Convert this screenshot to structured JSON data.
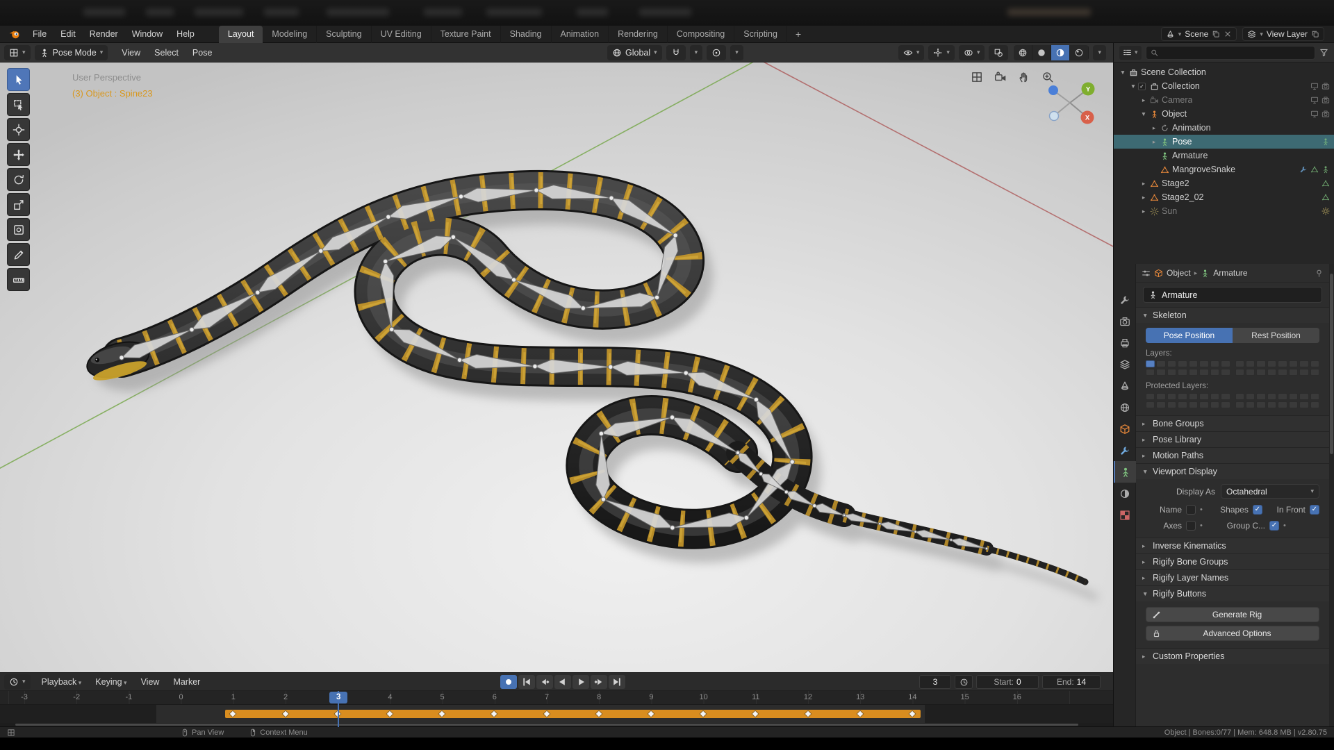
{
  "colors": {
    "accent": "#4772b3",
    "selection_teal": "#3d6a73",
    "keyframe_band": "#d98d1f",
    "snake_body": "#262626",
    "snake_band": "#c9992a",
    "axis_green": "#6da33c",
    "axis_red": "#a84848"
  },
  "icons": {
    "chevron-down": "▾",
    "triangle-right": "▸",
    "triangle-down": "▼",
    "dot": "•",
    "check": "✓"
  },
  "topbar": {
    "menus": [
      "File",
      "Edit",
      "Render",
      "Window",
      "Help"
    ],
    "workspaces": [
      "Layout",
      "Modeling",
      "Sculpting",
      "UV Editing",
      "Texture Paint",
      "Shading",
      "Animation",
      "Rendering",
      "Compositing",
      "Scripting"
    ],
    "active_workspace": "Layout",
    "add_tab_label": "+",
    "scene_label": "Scene",
    "view_layer_label": "View Layer"
  },
  "viewport_header": {
    "mode": "Pose Mode",
    "menus": [
      "View",
      "Select",
      "Pose"
    ],
    "orientation": "Global",
    "shading_modes": [
      "wireframe",
      "solid",
      "material-preview",
      "rendered"
    ],
    "shading_active": "material-preview"
  },
  "toolbar": {
    "tools": [
      {
        "name": "tweak",
        "icon": "pointer",
        "active": true
      },
      {
        "name": "select-box",
        "icon": "selectbox"
      },
      {
        "name": "cursor",
        "icon": "cursor3d"
      },
      {
        "name": "move",
        "icon": "move"
      },
      {
        "name": "rotate",
        "icon": "rotate"
      },
      {
        "name": "scale",
        "icon": "scale"
      },
      {
        "name": "transform",
        "icon": "transform"
      },
      {
        "name": "annotate",
        "icon": "annotate"
      },
      {
        "name": "measure",
        "icon": "measure"
      }
    ]
  },
  "viewport": {
    "perspective_label": "User Perspective",
    "object_label": "(3) Object : Spine23",
    "gizmo": {
      "x": "X",
      "y": "Y"
    },
    "nav_icons": [
      "grid",
      "camera",
      "hand",
      "zoom"
    ]
  },
  "outliner": {
    "rows": [
      {
        "label": "Scene Collection",
        "icon": "scenecol",
        "depth": 0,
        "caret": "down"
      },
      {
        "label": "Collection",
        "icon": "box",
        "depth": 1,
        "caret": "down",
        "check": true,
        "trail": [
          "monitor",
          "camback"
        ]
      },
      {
        "label": "Camera",
        "icon": "camera",
        "depth": 2,
        "caret": "right",
        "muted": true,
        "trail": [
          "monitor",
          "camback"
        ]
      },
      {
        "label": "Object",
        "icon": "personorange",
        "depth": 2,
        "caret": "down",
        "trail": [
          "monitor",
          "camback"
        ]
      },
      {
        "label": "Animation",
        "icon": "anim",
        "depth": 3,
        "caret": "right"
      },
      {
        "label": "Pose",
        "icon": "persongreen",
        "depth": 3,
        "caret": "right",
        "selected": true,
        "trail": [
          "persongreen"
        ]
      },
      {
        "label": "Armature",
        "icon": "persongreen",
        "depth": 3,
        "caret": "none"
      },
      {
        "label": "MangroveSnake",
        "icon": "meshorange",
        "depth": 3,
        "caret": "none",
        "trail": [
          "wrenchblue",
          "meshgreen",
          "persongreen"
        ]
      },
      {
        "label": "Stage2",
        "icon": "meshorange",
        "depth": 2,
        "caret": "right",
        "trail": [
          "meshgreen"
        ]
      },
      {
        "label": "Stage2_02",
        "icon": "meshorange",
        "depth": 2,
        "caret": "right",
        "trail": [
          "meshgreen"
        ]
      },
      {
        "label": "Sun",
        "icon": "sun",
        "depth": 2,
        "caret": "right",
        "muted": true,
        "trail": [
          "sun"
        ]
      }
    ]
  },
  "properties": {
    "tabs": [
      {
        "name": "tool",
        "icon": "wrench",
        "color": "#ababab"
      },
      {
        "name": "render",
        "icon": "camback",
        "color": "#ababab"
      },
      {
        "name": "output",
        "icon": "printer",
        "color": "#ababab"
      },
      {
        "name": "view-layer",
        "icon": "layersic",
        "color": "#ababab"
      },
      {
        "name": "scene",
        "icon": "cone",
        "color": "#ababab"
      },
      {
        "name": "world",
        "icon": "globe",
        "color": "#ababab"
      },
      {
        "name": "object",
        "icon": "cube",
        "color": "#e8883a"
      },
      {
        "name": "modifiers",
        "icon": "wrench",
        "color": "#6fa8dc"
      },
      {
        "name": "object-data",
        "icon": "person",
        "color": "#7ec17e",
        "active": true
      },
      {
        "name": "material",
        "icon": "spherehalf",
        "color": "#ababab"
      },
      {
        "name": "texture",
        "icon": "checker",
        "color": "#cc6666"
      }
    ],
    "breadcrumb": {
      "object": "Object",
      "data": "Armature"
    },
    "name_field": "Armature",
    "skeleton": {
      "title": "Skeleton",
      "pose_position": "Pose Position",
      "rest_position": "Rest Position",
      "layers_label": "Layers:",
      "protected_label": "Protected Layers:"
    },
    "collapsed_group_1": [
      "Bone Groups",
      "Pose Library",
      "Motion Paths"
    ],
    "viewport_display": {
      "title": "Viewport Display",
      "display_as_label": "Display As",
      "display_as_value": "Octahedral",
      "checkbox_rows": [
        [
          {
            "label": "Name",
            "checked": false,
            "dot": true
          },
          {
            "label": "Shapes",
            "checked": true
          },
          {
            "label": "In Front",
            "checked": true
          }
        ],
        [
          {
            "label": "Axes",
            "checked": false,
            "dot": true
          },
          {
            "label": "Group C...",
            "checked": true,
            "dot": true
          }
        ]
      ]
    },
    "collapsed_group_2": [
      "Inverse Kinematics",
      "Rigify Bone Groups",
      "Rigify Layer Names"
    ],
    "rigify_buttons": {
      "title": "Rigify Buttons",
      "generate": "Generate Rig",
      "advanced": "Advanced Options"
    },
    "collapsed_group_3": [
      "Custom Properties"
    ]
  },
  "timeline": {
    "menus": [
      {
        "label": "Playback",
        "caret": true
      },
      {
        "label": "Keying",
        "caret": true
      },
      {
        "label": "View",
        "caret": false
      },
      {
        "label": "Marker",
        "caret": false
      }
    ],
    "transport": [
      {
        "name": "auto-key",
        "icon": "record",
        "active": true
      },
      {
        "name": "jump-start",
        "icon": "tstart"
      },
      {
        "name": "prev-keyframe",
        "icon": "tprevkey"
      },
      {
        "name": "play-reverse",
        "icon": "tplayrev"
      },
      {
        "name": "play",
        "icon": "tplay"
      },
      {
        "name": "next-keyframe",
        "icon": "tnextkey"
      },
      {
        "name": "jump-end",
        "icon": "tend"
      }
    ],
    "current_frame": "3",
    "start_label": "Start:",
    "start_value": "0",
    "end_label": "End:",
    "end_value": "14",
    "tick_first": -3,
    "tick_last": 16,
    "keyframes": [
      1,
      2,
      3,
      4,
      5,
      6,
      7,
      8,
      9,
      10,
      11,
      12,
      13,
      14
    ],
    "range_start": 1,
    "range_end": 14
  },
  "statusbar": {
    "hints": [
      {
        "icon": "mousemid",
        "label": "Pan View"
      },
      {
        "icon": "mouseright",
        "label": "Context Menu"
      }
    ],
    "info": "Object | Bones:0/77 | Mem: 648.8 MB | v2.80.75"
  }
}
